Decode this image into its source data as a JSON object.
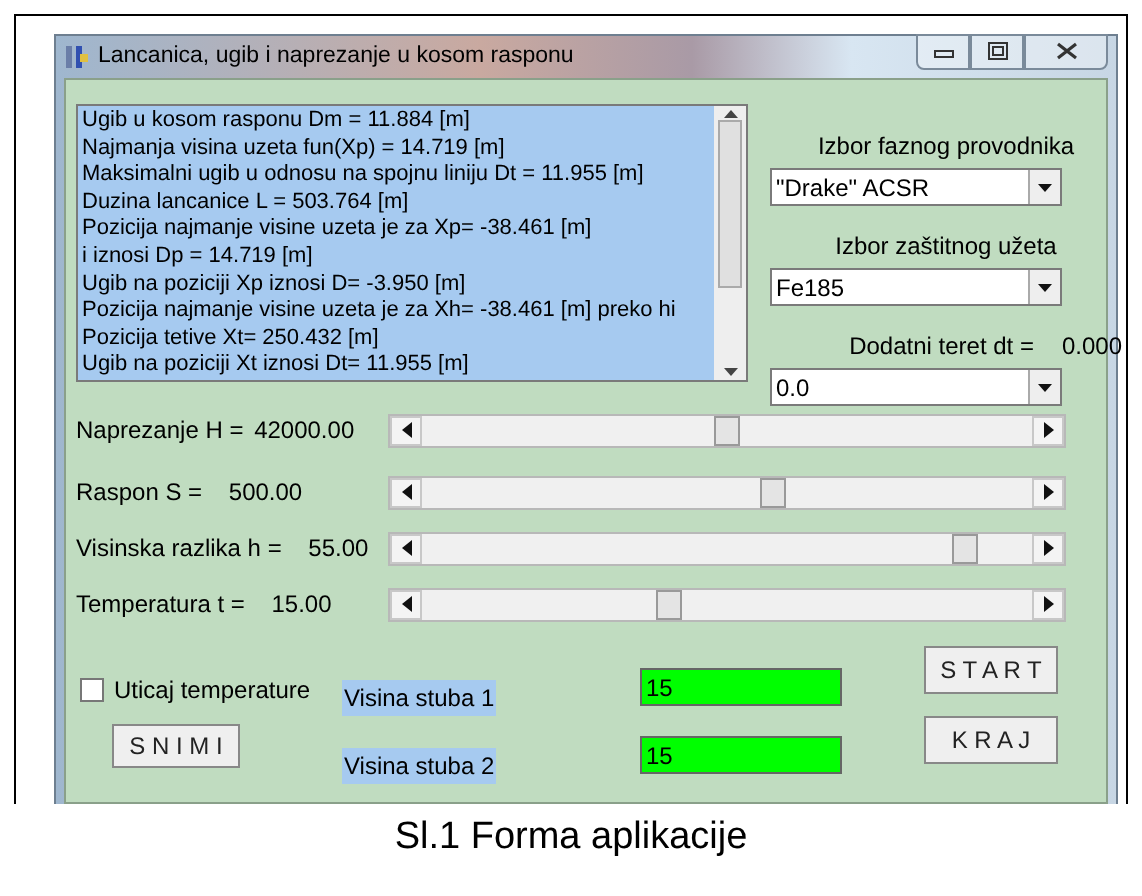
{
  "window": {
    "title": "Lancanica, ugib i naprezanje u kosom rasponu"
  },
  "results": [
    "Ugib u kosom rasponu Dm =  11.884 [m]",
    "Najmanja visina uzeta fun(Xp) =  14.719 [m]",
    "Maksimalni ugib u odnosu na spojnu liniju Dt =  11.955 [m]",
    "Duzina lancanice L = 503.764 [m]",
    "Pozicija najmanje visine uzeta je za  Xp=  -38.461 [m]",
    "i iznosi Dp =  14.719 [m]",
    "Ugib  na poziciji Xp iznosi D=  -3.950 [m]",
    "Pozicija najmanje visine uzeta je za  Xh=  -38.461 [m] preko hi",
    "Pozicija tetive  Xt=  250.432 [m]",
    "Ugib  na poziciji Xt iznosi Dt=  11.955 [m]"
  ],
  "selectors": [
    {
      "label": "Izbor faznog provodnika",
      "value": "\"Drake\" ACSR"
    },
    {
      "label": "Izbor zaštitnog užeta",
      "value": "Fe185"
    },
    {
      "label": "Dodatni teret dt =",
      "reading": "0.000",
      "value": "0.0"
    }
  ],
  "sliders": [
    {
      "label": "Naprezanje H =",
      "value": "42000.00"
    },
    {
      "label": "Raspon S =",
      "value": "500.00"
    },
    {
      "label": "Visinska razlika h =",
      "value": "55.00"
    },
    {
      "label": "Temperatura t =",
      "value": "15.00"
    }
  ],
  "temperature_checkbox": {
    "label": "Uticaj temperature",
    "checked": false
  },
  "save_button": "S N I M I",
  "heights": [
    {
      "label": "Visina stuba 1",
      "value": "15"
    },
    {
      "label": "Visina stuba 2",
      "value": "15"
    }
  ],
  "buttons": [
    "S T A R T",
    "K R A J"
  ],
  "caption": "Sl.1 Forma aplikacije"
}
